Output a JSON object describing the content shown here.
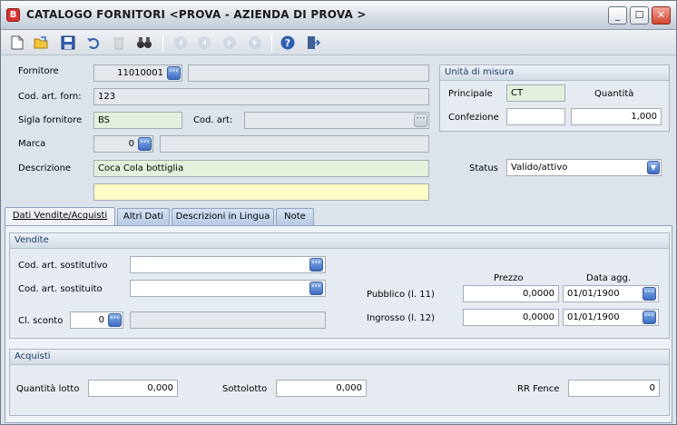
{
  "window": {
    "title": "CATALOGO FORNITORI <PROVA - AZIENDA DI PROVA >",
    "min": "_",
    "max": "☐",
    "close": "✕"
  },
  "toolbar": {
    "icons": [
      "new-document",
      "open-folder",
      "save",
      "undo",
      "delete",
      "find-binoculars",
      "first-record",
      "previous-record",
      "next-record",
      "last-record",
      "help",
      "exit-door"
    ]
  },
  "form": {
    "fornitore_label": "Fornitore",
    "fornitore_code": "11010001",
    "fornitore_name": "",
    "cod_art_forn_label": "Cod. art. forn:",
    "cod_art_forn_value": "123",
    "sigla_label": "Sigla fornitore",
    "sigla_value": "BS",
    "cod_art_label": "Cod. art:",
    "cod_art_value": "",
    "marca_label": "Marca",
    "marca_value": "0",
    "marca_desc": "",
    "descrizione_label": "Descrizione",
    "descrizione_value": "Coca Cola bottiglia",
    "descrizione2_value": "",
    "status_label": "Status",
    "status_value": "Valido/attivo"
  },
  "unita": {
    "title": "Unità di misura",
    "principale_label": "Principale",
    "principale_value": "CT",
    "quantita_label": "Quantità",
    "confezione_label": "Confezione",
    "confezione_value": "",
    "quantita_value": "1,000"
  },
  "tabs": [
    "Dati Vendite/Acquisti",
    "Altri Dati",
    "Descrizioni in Lingua",
    "Note"
  ],
  "vendite": {
    "title": "Vendite",
    "sostitutivo_label": "Cod. art. sostitutivo",
    "sostitutivo_value": "",
    "sostituito_label": "Cod. art. sostituito",
    "sostituito_value": "",
    "sconto_label": "Cl. sconto",
    "sconto_value": "0",
    "sconto_desc": "",
    "prezzo_header": "Prezzo",
    "data_header": "Data agg.",
    "pubblico_label": "Pubblico (l. 11)",
    "pubblico_prezzo": "0,0000",
    "pubblico_data": "01/01/1900",
    "ingrosso_label": "Ingrosso (l. 12)",
    "ingrosso_prezzo": "0,0000",
    "ingrosso_data": "01/01/1900"
  },
  "acquisti": {
    "title": "Acquisti",
    "lotto_label": "Quantità lotto",
    "lotto_value": "0,000",
    "sottolotto_label": "Sottolotto",
    "sottolotto_value": "0,000",
    "rr_label": "RR Fence",
    "rr_value": "0"
  },
  "colors": {
    "accent": "#3a6cc4",
    "green_field": "#e3f1dc",
    "yellow_field": "#fdfcc6",
    "tab": "#b6c9e4"
  }
}
